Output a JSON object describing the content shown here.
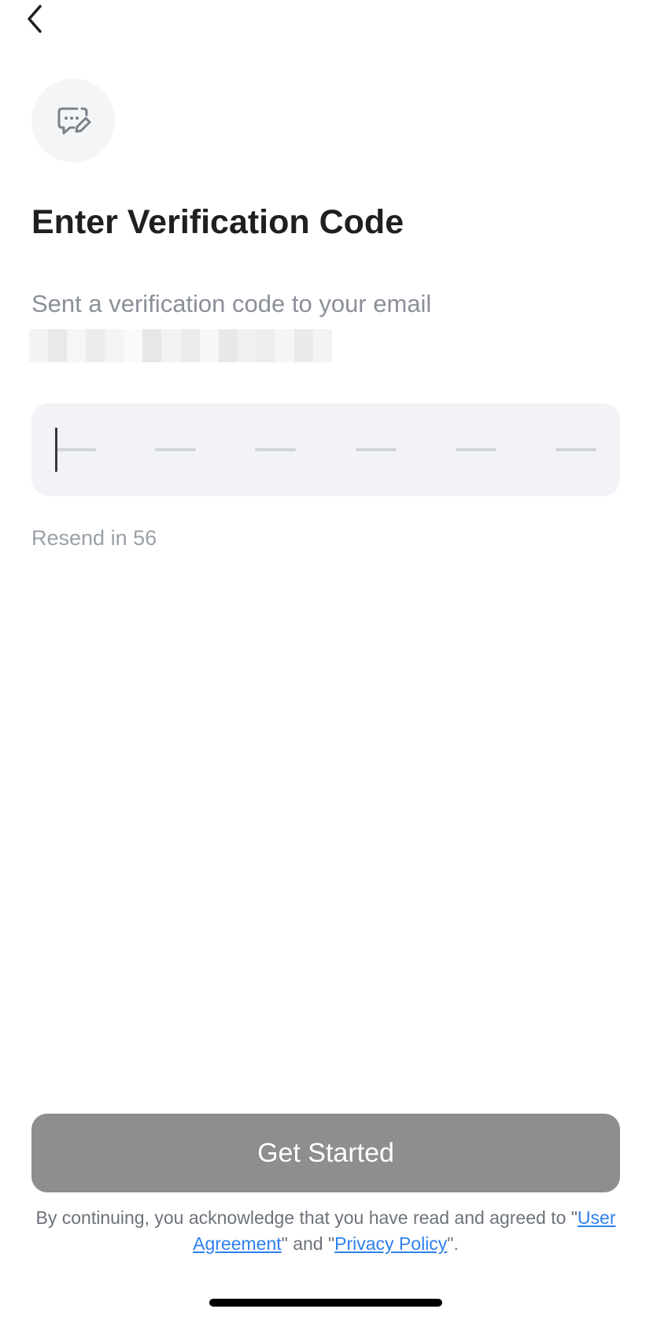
{
  "header": {
    "back_icon": "chevron-left-icon"
  },
  "hero": {
    "icon": "message-edit-icon"
  },
  "main": {
    "title": "Enter Verification Code",
    "subtitle": "Sent a verification code to your email",
    "code_slot_count": 6,
    "resend_label": "Resend in 56"
  },
  "footer": {
    "button_label": "Get Started",
    "legal_prefix": "By continuing, you acknowledge that you have read and agreed to \"",
    "user_agreement_label": "User Agreement",
    "legal_middle": "\" and \"",
    "privacy_policy_label": "Privacy Policy",
    "legal_suffix": "\"."
  },
  "colors": {
    "title": "#1f1f1f",
    "subtitle": "#8a8f98",
    "code_box_bg": "#f2f3f6",
    "button_bg": "#8e8e8e",
    "link": "#2f80ed"
  }
}
